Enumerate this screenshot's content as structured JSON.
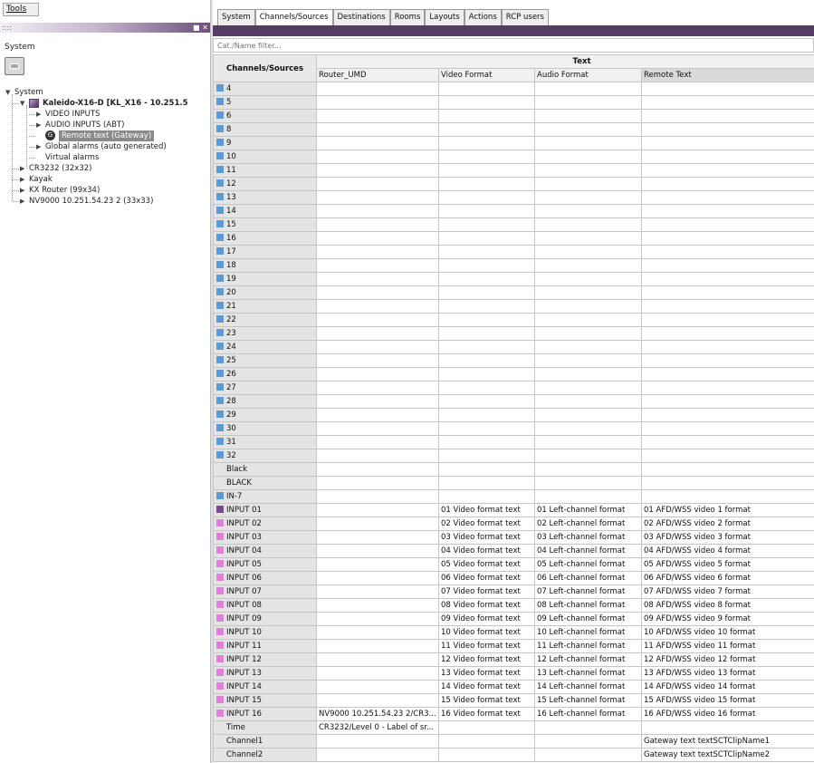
{
  "left": {
    "tools_label": "Tools",
    "grip": "::::",
    "header_buttons": "■ ✕",
    "title": "System",
    "tree": [
      {
        "label": "System",
        "level": 0,
        "twisty": "▼",
        "bold": false
      },
      {
        "label": "Kaleido-X16-D [KL_X16 - 10.251.5",
        "level": 1,
        "twisty": "▼",
        "bold": true,
        "icon": "device"
      },
      {
        "label": "VIDEO INPUTS",
        "level": 2,
        "twisty": "▶",
        "bold": false
      },
      {
        "label": "AUDIO INPUTS (ABT)",
        "level": 2,
        "twisty": "▶",
        "bold": false
      },
      {
        "label": "Remote text (Gateway)",
        "level": 2,
        "twisty": "",
        "bold": false,
        "icon": "gateway",
        "selected": true
      },
      {
        "label": "Global alarms (auto generated)",
        "level": 2,
        "twisty": "▶",
        "bold": false
      },
      {
        "label": "Virtual alarms",
        "level": 2,
        "twisty": "",
        "bold": false
      },
      {
        "label": "CR3232 (32x32)",
        "level": 1,
        "twisty": "▶",
        "bold": false
      },
      {
        "label": "Kayak",
        "level": 1,
        "twisty": "▶",
        "bold": false
      },
      {
        "label": "KX Router (99x34)",
        "level": 1,
        "twisty": "▶",
        "bold": false
      },
      {
        "label": "NV9000 10.251.54.23 2 (33x33)",
        "level": 1,
        "twisty": "▶",
        "bold": false
      }
    ]
  },
  "tabs": [
    {
      "label": "System",
      "active": false
    },
    {
      "label": "Channels/Sources",
      "active": true
    },
    {
      "label": "Destinations",
      "active": false
    },
    {
      "label": "Rooms",
      "active": false
    },
    {
      "label": "Layouts",
      "active": false
    },
    {
      "label": "Actions",
      "active": false
    },
    {
      "label": "RCP users",
      "active": false
    }
  ],
  "filter": {
    "placeholder": "Cat./Name filter..."
  },
  "grid": {
    "group_header": "Text",
    "channel_header": "Channels/Sources",
    "columns": [
      "Router_UMD",
      "Video Format",
      "Audio Format",
      "Remote Text"
    ],
    "colors": {
      "blue": "#5b9bd5",
      "pink": "#e27fd8",
      "purple": "#7a4a8c"
    },
    "rows": [
      {
        "name": "4",
        "swatch": "blue"
      },
      {
        "name": "5",
        "swatch": "blue"
      },
      {
        "name": "6",
        "swatch": "blue"
      },
      {
        "name": "8",
        "swatch": "blue"
      },
      {
        "name": "9",
        "swatch": "blue"
      },
      {
        "name": "10",
        "swatch": "blue"
      },
      {
        "name": "11",
        "swatch": "blue"
      },
      {
        "name": "12",
        "swatch": "blue"
      },
      {
        "name": "13",
        "swatch": "blue"
      },
      {
        "name": "14",
        "swatch": "blue"
      },
      {
        "name": "15",
        "swatch": "blue"
      },
      {
        "name": "16",
        "swatch": "blue"
      },
      {
        "name": "17",
        "swatch": "blue"
      },
      {
        "name": "18",
        "swatch": "blue"
      },
      {
        "name": "19",
        "swatch": "blue"
      },
      {
        "name": "20",
        "swatch": "blue"
      },
      {
        "name": "21",
        "swatch": "blue"
      },
      {
        "name": "22",
        "swatch": "blue"
      },
      {
        "name": "23",
        "swatch": "blue"
      },
      {
        "name": "24",
        "swatch": "blue"
      },
      {
        "name": "25",
        "swatch": "blue"
      },
      {
        "name": "26",
        "swatch": "blue"
      },
      {
        "name": "27",
        "swatch": "blue"
      },
      {
        "name": "28",
        "swatch": "blue"
      },
      {
        "name": "29",
        "swatch": "blue"
      },
      {
        "name": "30",
        "swatch": "blue"
      },
      {
        "name": "31",
        "swatch": "blue"
      },
      {
        "name": "32",
        "swatch": "blue"
      },
      {
        "name": "Black",
        "swatch": ""
      },
      {
        "name": "BLACK",
        "swatch": ""
      },
      {
        "name": "IN-7",
        "swatch": "blue"
      },
      {
        "name": "INPUT 01",
        "swatch": "purple",
        "video": "01  Video format text",
        "audio": "01  Left-channel format",
        "remote": "01  AFD/WSS video 1 format"
      },
      {
        "name": "INPUT 02",
        "swatch": "pink",
        "video": "02  Video format text",
        "audio": "02  Left-channel format",
        "remote": "02  AFD/WSS video 2 format"
      },
      {
        "name": "INPUT 03",
        "swatch": "pink",
        "video": "03  Video format text",
        "audio": "03  Left-channel format",
        "remote": "03  AFD/WSS video 3 format"
      },
      {
        "name": "INPUT 04",
        "swatch": "pink",
        "video": "04  Video format text",
        "audio": "04  Left-channel format",
        "remote": "04  AFD/WSS video 4 format"
      },
      {
        "name": "INPUT 05",
        "swatch": "pink",
        "video": "05  Video format text",
        "audio": "05  Left-channel format",
        "remote": "05  AFD/WSS video 5 format"
      },
      {
        "name": "INPUT 06",
        "swatch": "pink",
        "video": "06  Video format text",
        "audio": "06  Left-channel format",
        "remote": "06  AFD/WSS video 6 format"
      },
      {
        "name": "INPUT 07",
        "swatch": "pink",
        "video": "07  Video format text",
        "audio": "07  Left-channel format",
        "remote": "07  AFD/WSS video 7 format"
      },
      {
        "name": "INPUT 08",
        "swatch": "pink",
        "video": "08  Video format text",
        "audio": "08  Left-channel format",
        "remote": "08  AFD/WSS video 8 format"
      },
      {
        "name": "INPUT 09",
        "swatch": "pink",
        "video": "09  Video format text",
        "audio": "09  Left-channel format",
        "remote": "09  AFD/WSS video 9 format"
      },
      {
        "name": "INPUT 10",
        "swatch": "pink",
        "video": "10  Video format text",
        "audio": "10  Left-channel format",
        "remote": "10  AFD/WSS video 10 format"
      },
      {
        "name": "INPUT 11",
        "swatch": "pink",
        "video": "11  Video format text",
        "audio": "11  Left-channel format",
        "remote": "11  AFD/WSS video 11 format"
      },
      {
        "name": "INPUT 12",
        "swatch": "pink",
        "video": "12  Video format text",
        "audio": "12  Left-channel format",
        "remote": "12  AFD/WSS video 12 format"
      },
      {
        "name": "INPUT 13",
        "swatch": "pink",
        "video": "13  Video format text",
        "audio": "13  Left-channel format",
        "remote": "13  AFD/WSS video 13 format"
      },
      {
        "name": "INPUT 14",
        "swatch": "pink",
        "video": "14  Video format text",
        "audio": "14  Left-channel format",
        "remote": "14  AFD/WSS video 14 format"
      },
      {
        "name": "INPUT 15",
        "swatch": "pink",
        "video": "15  Video format text",
        "audio": "15  Left-channel format",
        "remote": "15  AFD/WSS video 15 format"
      },
      {
        "name": "INPUT 16",
        "swatch": "pink",
        "router": "NV9000 10.251.54.23 2/CR3...",
        "video": "16  Video format text",
        "audio": "16  Left-channel format",
        "remote": "16  AFD/WSS video 16 format"
      },
      {
        "name": "Time",
        "swatch": "",
        "router": "CR3232/Level 0 - Label of sr..."
      },
      {
        "name": "Channel1",
        "swatch": "",
        "remote": "Gateway text textSCTClipName1"
      },
      {
        "name": "Channel2",
        "swatch": "",
        "remote": "Gateway text textSCTClipName2"
      }
    ]
  }
}
